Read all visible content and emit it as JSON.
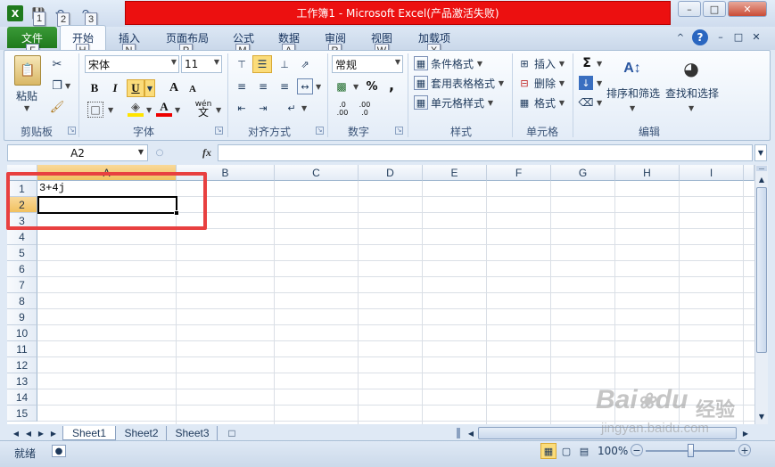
{
  "window": {
    "title": "工作簿1 - Microsoft Excel(产品激活失败)",
    "min_btn": "–",
    "max_btn": "□",
    "close_btn": "✕",
    "doc_min": "–",
    "doc_max": "□",
    "doc_close": "✕"
  },
  "quick_access": {
    "keytips": [
      "1",
      "2",
      "3"
    ]
  },
  "tabs": {
    "file": "文件",
    "home": "开始",
    "insert": "插入",
    "layout": "页面布局",
    "formulas": "公式",
    "data": "数据",
    "review": "审阅",
    "view": "视图",
    "addins": "加载项",
    "keytips": {
      "file": "F",
      "home": "H",
      "insert": "N",
      "layout": "P",
      "formulas": "M",
      "data": "A",
      "review": "R",
      "view": "W",
      "addins": "X"
    }
  },
  "ribbon": {
    "clipboard": {
      "label": "剪贴板",
      "paste": "粘贴"
    },
    "font": {
      "label": "字体",
      "font_name": "宋体",
      "font_size": "11",
      "bold": "B",
      "italic": "I",
      "underline": "U",
      "grow": "A",
      "shrink": "A",
      "wen": "wén",
      "wen_char": "文"
    },
    "alignment": {
      "label": "对齐方式"
    },
    "number": {
      "label": "数字",
      "format": "常规",
      "percent": "%",
      "comma": ",",
      "inc_dec": ".0\n.00",
      "dec_dec": ".00\n.0"
    },
    "styles": {
      "label": "样式",
      "conditional": "条件格式",
      "table": "套用表格格式",
      "cell_styles": "单元格样式"
    },
    "cells": {
      "label": "单元格",
      "insert": "插入",
      "delete": "删除",
      "format": "格式"
    },
    "editing": {
      "label": "编辑",
      "sort": "排序和筛选",
      "find": "查找和选择",
      "sigma": "Σ"
    }
  },
  "formula_bar": {
    "name_box": "A2",
    "fx": "fx",
    "content": ""
  },
  "grid": {
    "columns": [
      "A",
      "B",
      "C",
      "D",
      "E",
      "F",
      "G",
      "H",
      "I"
    ],
    "rows": [
      "1",
      "2",
      "3",
      "4",
      "5",
      "6",
      "7",
      "8",
      "9",
      "10",
      "11",
      "12",
      "13",
      "14",
      "15"
    ],
    "cells": {
      "A1": "3+4j"
    },
    "active_cell": "A2"
  },
  "sheets": {
    "tabs": [
      "Sheet1",
      "Sheet2",
      "Sheet3"
    ],
    "active": "Sheet1"
  },
  "status": {
    "ready": "就绪",
    "zoom": "100%",
    "zoom_minus": "−",
    "zoom_plus": "+"
  },
  "watermark": {
    "brand": "Bai",
    "brand2": "du",
    "jingyan": "经验",
    "url": "jingyan.baidu.com"
  },
  "colors": {
    "title_bar": "#ec1010",
    "file_tab": "#2a8a28",
    "highlight": "#e84040"
  }
}
